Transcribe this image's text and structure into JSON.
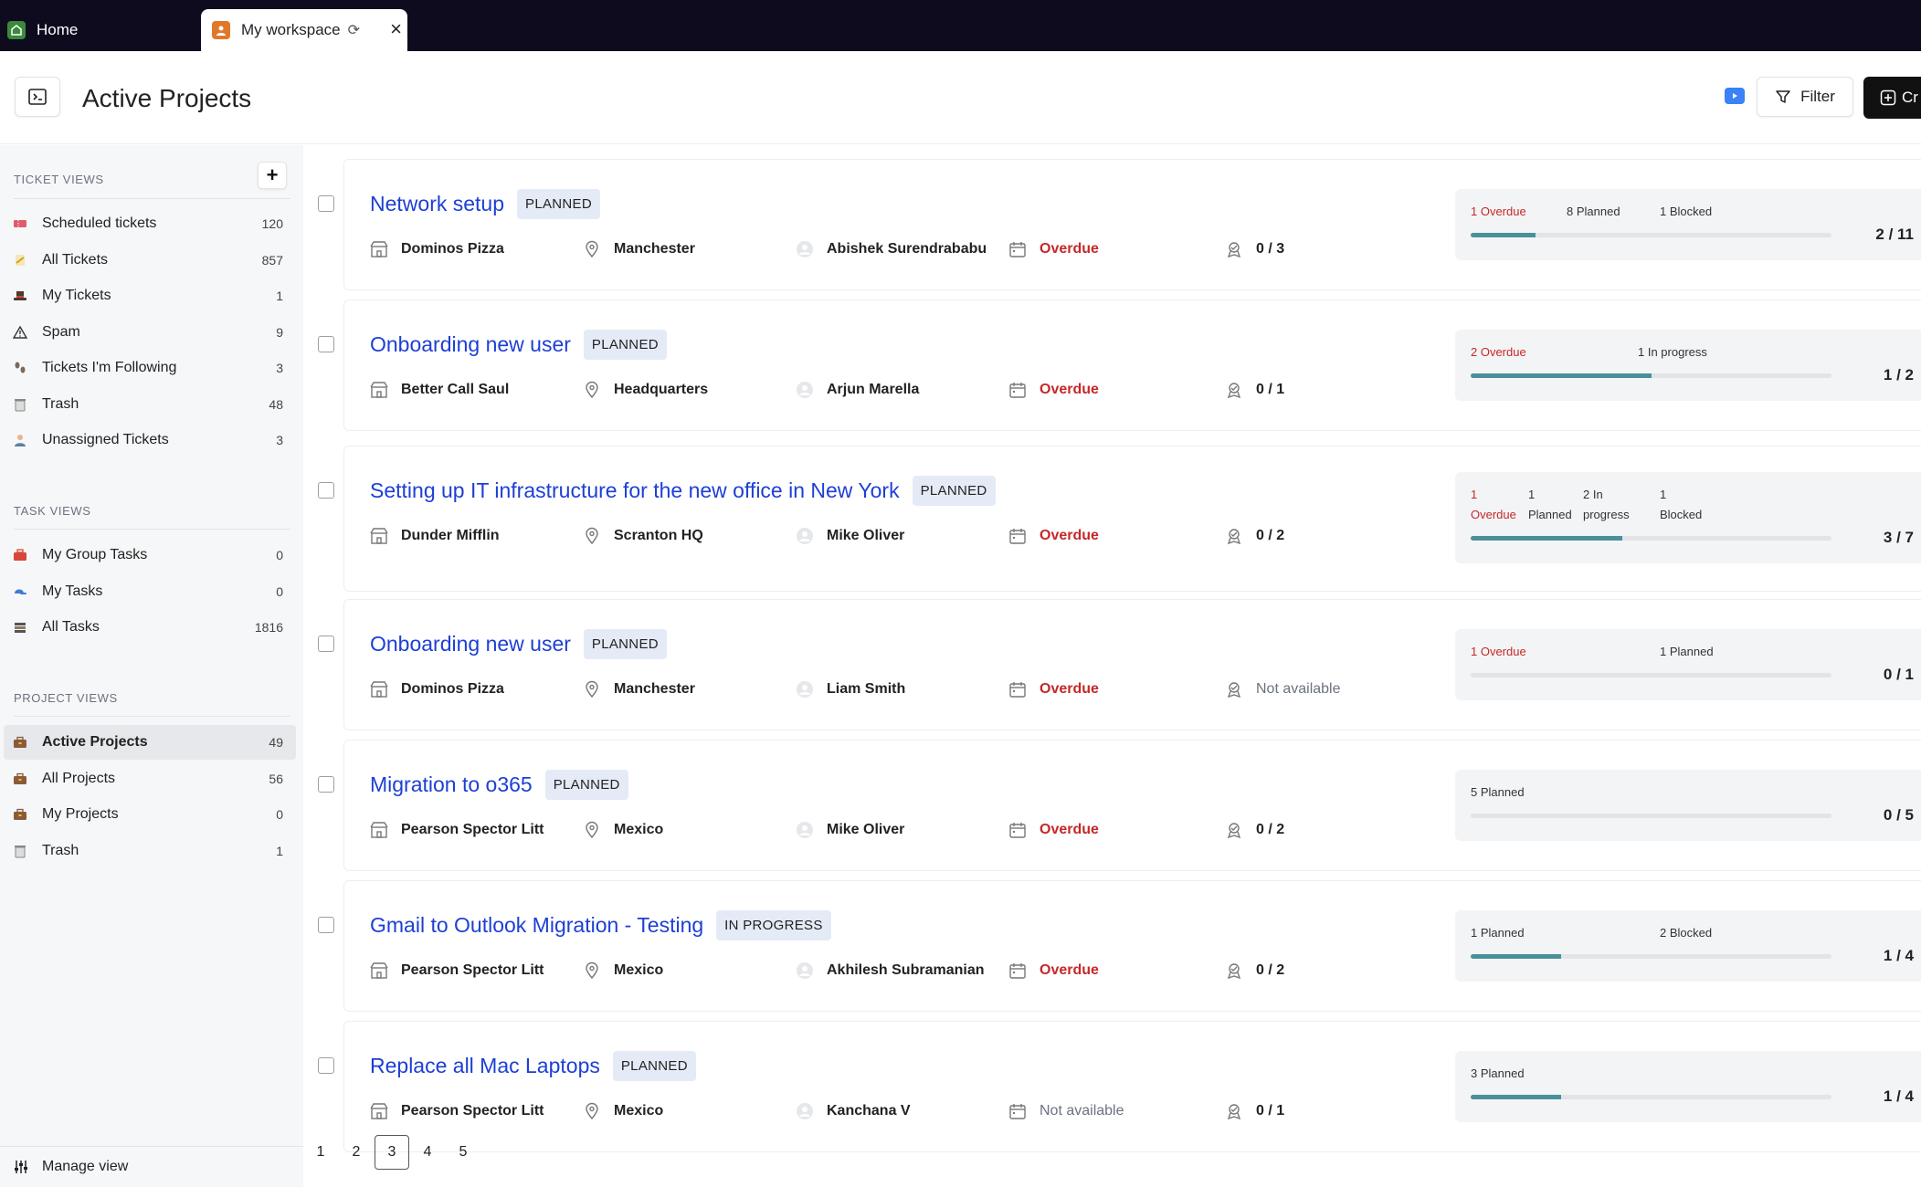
{
  "tabs": [
    {
      "label": "Home"
    },
    {
      "label": "My workspace"
    }
  ],
  "header": {
    "title": "Active Projects",
    "filter_label": "Filter",
    "create_label": "Cr"
  },
  "sidebar": {
    "ticket_views_title": "TICKET VIEWS",
    "ticket_views": [
      {
        "label": "Scheduled tickets",
        "count": "120",
        "icon": "ticket-icon",
        "color": "#e05a6b"
      },
      {
        "label": "All Tickets",
        "count": "857",
        "icon": "memo-icon",
        "color": "#d4a017"
      },
      {
        "label": "My Tickets",
        "count": "1",
        "icon": "hat-icon",
        "color": "#4a3b2a"
      },
      {
        "label": "Spam",
        "count": "9",
        "icon": "warning-icon",
        "color": "#333333"
      },
      {
        "label": "Tickets I'm Following",
        "count": "3",
        "icon": "footprints-icon",
        "color": "#7a6a5a"
      },
      {
        "label": "Trash",
        "count": "48",
        "icon": "trash-icon",
        "color": "#888888"
      },
      {
        "label": "Unassigned Tickets",
        "count": "3",
        "icon": "person-icon",
        "color": "#5b7fa6"
      }
    ],
    "task_views_title": "TASK VIEWS",
    "task_views": [
      {
        "label": "My Group Tasks",
        "count": "0",
        "icon": "toolbox-icon",
        "color": "#d9463b"
      },
      {
        "label": "My Tasks",
        "count": "0",
        "icon": "cap-icon",
        "color": "#3b7bd9"
      },
      {
        "label": "All Tasks",
        "count": "1816",
        "icon": "stack-icon",
        "color": "#555555"
      }
    ],
    "project_views_title": "PROJECT VIEWS",
    "project_views": [
      {
        "label": "Active Projects",
        "count": "49",
        "icon": "briefcase-icon",
        "color": "#8b5a3c"
      },
      {
        "label": "All Projects",
        "count": "56",
        "icon": "briefcase-icon",
        "color": "#8b5a3c"
      },
      {
        "label": "My Projects",
        "count": "0",
        "icon": "briefcase-icon",
        "color": "#8b5a3c"
      },
      {
        "label": "Trash",
        "count": "1",
        "icon": "trash-icon",
        "color": "#888888"
      }
    ],
    "manage_view_label": "Manage view"
  },
  "colors": {
    "title_link": "#1d3fd6",
    "overdue": "#c62828",
    "progress_fill": "#4a8f99"
  },
  "projects": [
    {
      "title": "Network setup",
      "status": "PLANNED",
      "company": "Dominos Pizza",
      "location": "Manchester",
      "assignee": "Abishek Surendrababu",
      "due": "Overdue",
      "due_overdue": true,
      "tasks": "0 / 3",
      "tasks_available": true,
      "progress": {
        "labels": [
          [
            "1 Overdue"
          ],
          [
            "8 Planned"
          ],
          [
            "1 Blocked"
          ]
        ],
        "ratio": "2 / 11",
        "fraction": 0.18
      }
    },
    {
      "title": "Onboarding new user",
      "status": "PLANNED",
      "company": "Better Call Saul",
      "location": "Headquarters",
      "assignee": "Arjun Marella",
      "due": "Overdue",
      "due_overdue": true,
      "tasks": "0 / 1",
      "tasks_available": true,
      "progress": {
        "labels": [
          [
            "2 Overdue"
          ],
          [
            "1 In progress"
          ]
        ],
        "ratio": "1 / 2",
        "fraction": 0.5
      }
    },
    {
      "title": "Setting up IT infrastructure for the new office in New York",
      "status": "PLANNED",
      "company": "Dunder Mifflin",
      "location": "Scranton HQ",
      "assignee": "Mike Oliver",
      "due": "Overdue",
      "due_overdue": true,
      "tasks": "0 / 2",
      "tasks_available": true,
      "progress": {
        "labels": [
          [
            "1",
            "Overdue"
          ],
          [
            "1",
            "Planned"
          ],
          [
            "2 In",
            "progress"
          ],
          [
            "1",
            "Blocked"
          ]
        ],
        "ratio": "3 / 7",
        "fraction": 0.42
      }
    },
    {
      "title": "Onboarding new user",
      "status": "PLANNED",
      "company": "Dominos Pizza",
      "location": "Manchester",
      "assignee": "Liam Smith",
      "due": "Overdue",
      "due_overdue": true,
      "tasks": "Not available",
      "tasks_available": false,
      "progress": {
        "labels": [
          [
            "1 Overdue"
          ],
          [
            "1 Planned"
          ]
        ],
        "ratio": "0 / 1",
        "fraction": 0
      }
    },
    {
      "title": "Migration to o365",
      "status": "PLANNED",
      "company": "Pearson Spector Litt",
      "location": "Mexico",
      "assignee": "Mike Oliver",
      "due": "Overdue",
      "due_overdue": true,
      "tasks": "0 / 2",
      "tasks_available": true,
      "progress": {
        "labels": [
          [
            "5 Planned"
          ]
        ],
        "ratio": "0 / 5",
        "fraction": 0
      }
    },
    {
      "title": "Gmail to Outlook Migration - Testing",
      "status": "IN PROGRESS",
      "company": "Pearson Spector Litt",
      "location": "Mexico",
      "assignee": "Akhilesh Subramanian",
      "due": "Overdue",
      "due_overdue": true,
      "tasks": "0 / 2",
      "tasks_available": true,
      "progress": {
        "labels": [
          [
            "1 Planned"
          ],
          [
            "2 Blocked"
          ]
        ],
        "ratio": "1 / 4",
        "fraction": 0.25
      }
    },
    {
      "title": "Replace all Mac Laptops",
      "status": "PLANNED",
      "company": "Pearson Spector Litt",
      "location": "Mexico",
      "assignee": "Kanchana V",
      "due": "Not available",
      "due_overdue": false,
      "tasks": "0 / 1",
      "tasks_available": true,
      "progress": {
        "labels": [
          [
            "3 Planned"
          ]
        ],
        "ratio": "1 / 4",
        "fraction": 0.25
      }
    }
  ],
  "pagination": {
    "pages": [
      "1",
      "2",
      "3",
      "4",
      "5"
    ],
    "current": "3"
  }
}
